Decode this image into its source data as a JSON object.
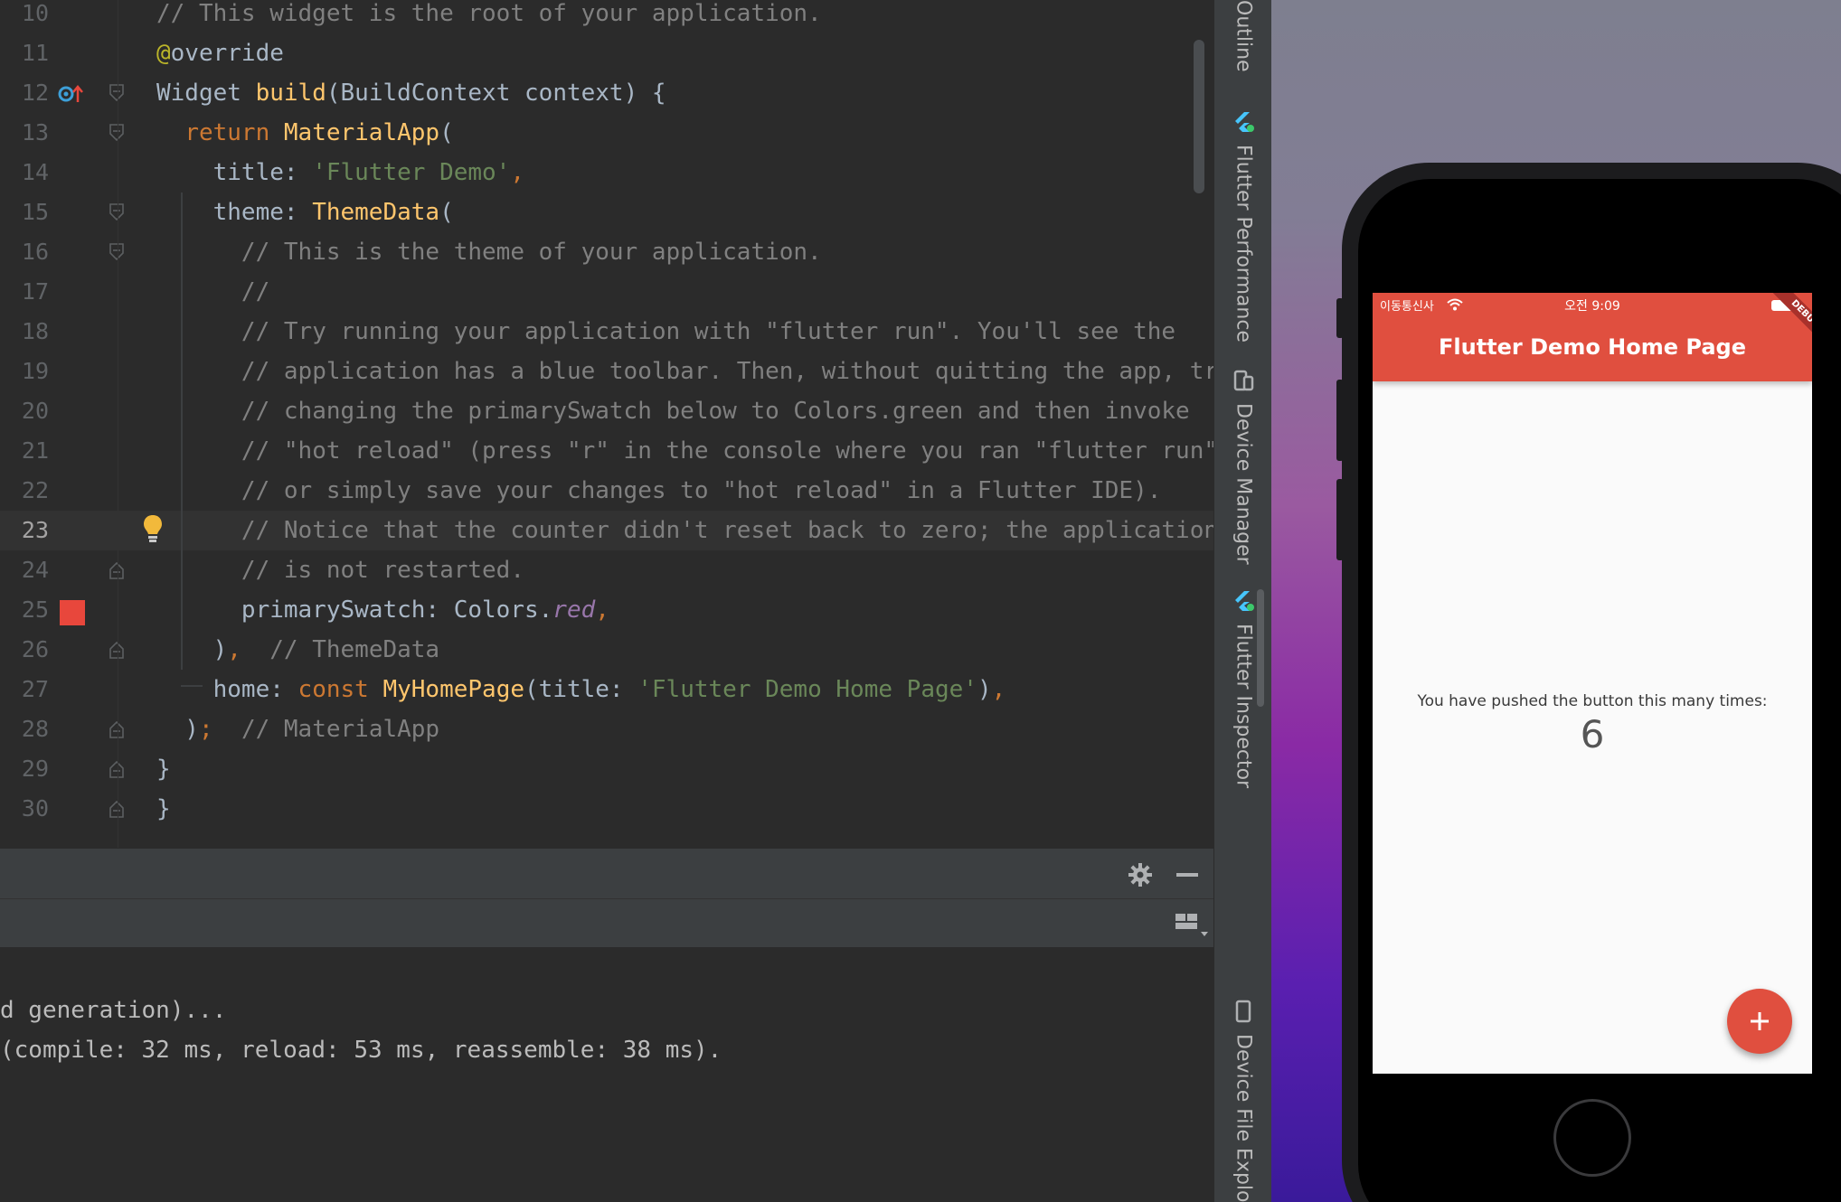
{
  "editor": {
    "lines": [
      {
        "num": "10",
        "tokens": [
          [
            "cm",
            "// This widget is the root of your application."
          ]
        ]
      },
      {
        "num": "11",
        "tokens": [
          [
            "ann",
            "@"
          ],
          [
            "pl",
            "override"
          ]
        ]
      },
      {
        "num": "12",
        "tokens": [
          [
            "pl",
            "Widget "
          ],
          [
            "fn",
            "build"
          ],
          [
            "pl",
            "(BuildContext context) {"
          ]
        ]
      },
      {
        "num": "13",
        "tokens": [
          [
            "pl",
            "  "
          ],
          [
            "kw",
            "return "
          ],
          [
            "fn",
            "MaterialApp"
          ],
          [
            "pl",
            "("
          ]
        ]
      },
      {
        "num": "14",
        "tokens": [
          [
            "pl",
            "    title: "
          ],
          [
            "str",
            "'Flutter Demo'"
          ],
          [
            "kw",
            ","
          ]
        ]
      },
      {
        "num": "15",
        "tokens": [
          [
            "pl",
            "    theme: "
          ],
          [
            "fn",
            "ThemeData"
          ],
          [
            "pl",
            "("
          ]
        ]
      },
      {
        "num": "16",
        "tokens": [
          [
            "pl",
            "      "
          ],
          [
            "cm",
            "// This is the theme of your application."
          ]
        ]
      },
      {
        "num": "17",
        "tokens": [
          [
            "pl",
            "      "
          ],
          [
            "cm",
            "//"
          ]
        ]
      },
      {
        "num": "18",
        "tokens": [
          [
            "pl",
            "      "
          ],
          [
            "cm",
            "// Try running your application with \"flutter run\". You'll see the"
          ]
        ]
      },
      {
        "num": "19",
        "tokens": [
          [
            "pl",
            "      "
          ],
          [
            "cm",
            "// application has a blue toolbar. Then, without quitting the app, tr"
          ]
        ]
      },
      {
        "num": "20",
        "tokens": [
          [
            "pl",
            "      "
          ],
          [
            "cm",
            "// changing the primarySwatch below to Colors.green and then invoke"
          ]
        ]
      },
      {
        "num": "21",
        "tokens": [
          [
            "pl",
            "      "
          ],
          [
            "cm",
            "// \"hot reload\" (press \"r\" in the console where you ran \"flutter run\""
          ]
        ]
      },
      {
        "num": "22",
        "tokens": [
          [
            "pl",
            "      "
          ],
          [
            "cm",
            "// or simply save your changes to \"hot reload\" in a Flutter IDE)."
          ]
        ]
      },
      {
        "num": "23",
        "tokens": [
          [
            "pl",
            "      "
          ],
          [
            "cm",
            "// Notice that the counter didn't reset back to zero; the application"
          ]
        ]
      },
      {
        "num": "24",
        "tokens": [
          [
            "pl",
            "      "
          ],
          [
            "cm",
            "// is not restarted."
          ]
        ]
      },
      {
        "num": "25",
        "tokens": [
          [
            "pl",
            "      primarySwatch: Colors."
          ],
          [
            "it",
            "red"
          ],
          [
            "kw",
            ","
          ]
        ]
      },
      {
        "num": "26",
        "tokens": [
          [
            "pl",
            "    )"
          ],
          [
            "kw",
            ","
          ],
          [
            "pl",
            "  "
          ],
          [
            "cm",
            "// ThemeData"
          ]
        ]
      },
      {
        "num": "27",
        "tokens": [
          [
            "pl",
            "    home: "
          ],
          [
            "kw",
            "const "
          ],
          [
            "fn",
            "MyHomePage"
          ],
          [
            "pl",
            "(title: "
          ],
          [
            "str",
            "'Flutter Demo Home Page'"
          ],
          [
            "pl",
            ")"
          ],
          [
            "kw",
            ","
          ]
        ]
      },
      {
        "num": "28",
        "tokens": [
          [
            "pl",
            "  )"
          ],
          [
            "kw",
            ";"
          ],
          [
            "pl",
            "  "
          ],
          [
            "cm",
            "// MaterialApp"
          ]
        ]
      },
      {
        "num": "29",
        "tokens": [
          [
            "pl",
            "}"
          ]
        ]
      },
      {
        "num": "30",
        "tokens": [
          [
            "pl",
            "}"
          ]
        ]
      }
    ],
    "current_line": "23"
  },
  "console": {
    "lines": [
      "d generation)...",
      "(compile: 32 ms, reload: 53 ms, reassemble: 38 ms)."
    ]
  },
  "tool_strip": {
    "outline": "Outline",
    "flutter_performance": "Flutter Performance",
    "device_manager": "Device Manager",
    "flutter_inspector": "Flutter Inspector",
    "device_file_explorer": "Device File Explore"
  },
  "phone": {
    "carrier": "이동통신사",
    "time": "오전 9:09",
    "app_title": "Flutter Demo Home Page",
    "debug_banner": "DEBUG",
    "counter_label": "You have pushed the button this many times:",
    "counter_value": "6",
    "fab_icon": "+"
  },
  "colors": {
    "editor_bg": "#2b2b2b",
    "appbar": "#e04f3f",
    "breakpoint": "#e8473c",
    "bulb": "#f2b93b"
  }
}
